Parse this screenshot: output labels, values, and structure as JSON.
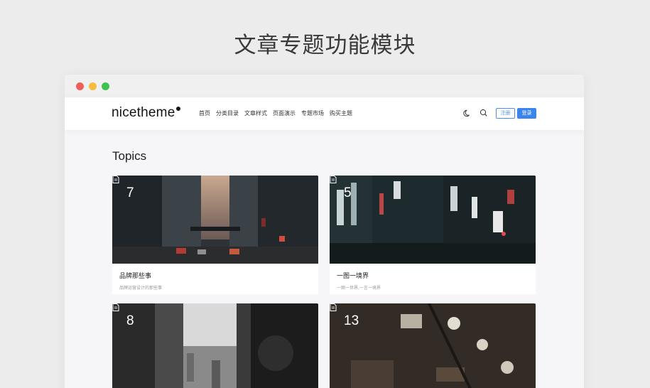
{
  "page_heading": "文章专题功能模块",
  "navbar": {
    "logo": "nicetheme",
    "menu": [
      "首页",
      "分类目录",
      "文章样式",
      "页面演示",
      "专题市场",
      "购买主题"
    ],
    "register_label": "注册",
    "login_label": "登录"
  },
  "section_title": "Topics",
  "topics": [
    {
      "count": "7",
      "title": "品牌那些事",
      "desc": "品牌运营设计的那些事"
    },
    {
      "count": "5",
      "title": "一图一境界",
      "desc": "一图一世界,一言一境界"
    },
    {
      "count": "8",
      "title": "",
      "desc": ""
    },
    {
      "count": "13",
      "title": "",
      "desc": ""
    }
  ],
  "colors": {
    "accent": "#3a84ee",
    "window_red": "#ef5f58",
    "window_yellow": "#f6bd3c",
    "window_green": "#3fc34f"
  }
}
